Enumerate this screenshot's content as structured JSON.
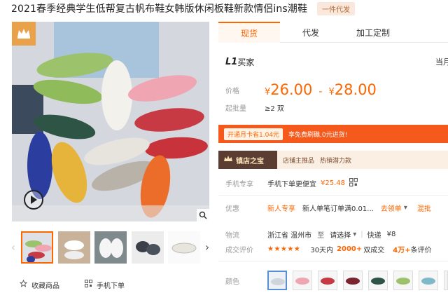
{
  "product": {
    "title": "2021春季经典学生低帮复古帆布鞋女韩版休闲板鞋新款情侣ins潮鞋",
    "consign_badge": "一件代发"
  },
  "tabs": [
    {
      "label": "现货",
      "active": true
    },
    {
      "label": "代发",
      "active": false
    },
    {
      "label": "加工定制",
      "active": false
    }
  ],
  "seller": {
    "level": "L1",
    "label": "买家",
    "right_text": "当月"
  },
  "price": {
    "label": "价格",
    "currency": "¥",
    "min": "26.00",
    "max": "28.00"
  },
  "moq": {
    "label": "起批量",
    "value": "≥2 双"
  },
  "promo": {
    "chip": "开通月卡省1.04元",
    "text": "享免费刷礁,0元进货!"
  },
  "treasure": {
    "title": "镇店之宝",
    "items": [
      "店铺主推品",
      "热销潜力款"
    ]
  },
  "mobile_deal": {
    "label": "手机专享",
    "text": "手机下单更便宜",
    "price": "¥25.48"
  },
  "offers": {
    "label": "优惠",
    "new_user": "新人专享",
    "text": "新人单笔订单满0.01...",
    "claim": "去领单",
    "mixed": "混批"
  },
  "logistics": {
    "label": "物流",
    "from": "浙江省 温州市",
    "to_word": "至",
    "to": "请选择",
    "express": "快递",
    "fee": "¥8"
  },
  "reviews": {
    "label": "成交评价",
    "stars": "★★★★★",
    "period": "30天内",
    "deals": "2000+",
    "deals_suffix": "双成交",
    "count": "4万+",
    "count_suffix": "条评价"
  },
  "colors": {
    "label": "颜色",
    "swatches": [
      "white",
      "pink",
      "red",
      "burgundy",
      "green",
      "mint",
      "blue",
      "grey"
    ]
  },
  "gallery": {
    "thumbs": 5,
    "active": 0
  },
  "actions": {
    "favorite": "收藏商品",
    "mobile_order": "手机下单"
  },
  "colors_theme": {
    "accent": "#ff6600",
    "promo_bg": "#f55a1c",
    "treasure_bg": "#fbefe4",
    "treasure_head": "#5b3d32",
    "crown": "#e9a24a"
  }
}
